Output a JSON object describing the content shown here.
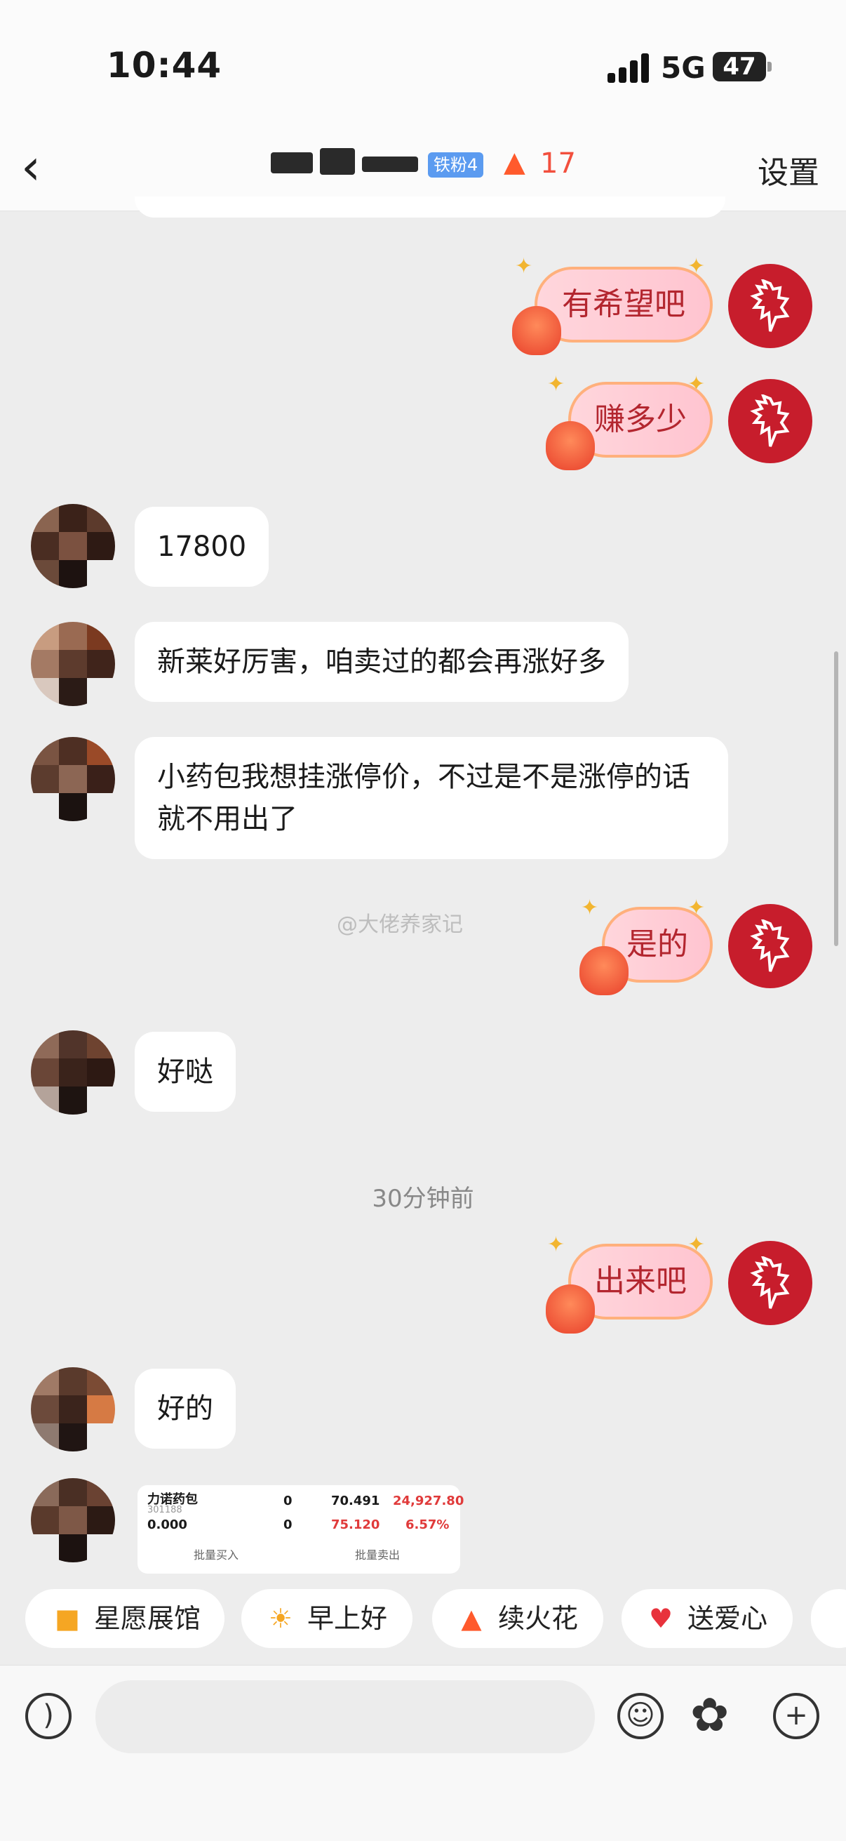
{
  "status_bar": {
    "time": "10:44",
    "network": "5G",
    "battery": "47"
  },
  "header": {
    "fan_badge": "铁粉4",
    "streak_count": "17",
    "settings_label": "设置"
  },
  "messages": [
    {
      "side": "right",
      "text": "有希望吧"
    },
    {
      "side": "right",
      "text": "赚多少"
    },
    {
      "side": "left",
      "text": "17800"
    },
    {
      "side": "left",
      "text": "新莱好厉害，咱卖过的都会再涨好多"
    },
    {
      "side": "left",
      "text": "小药包我想挂涨停价，不过是不是涨停的话就不用出了"
    },
    {
      "side": "right",
      "text": "是的"
    },
    {
      "side": "left",
      "text": "好哒"
    },
    {
      "side": "right",
      "text": "出来吧"
    },
    {
      "side": "left",
      "text": "好的"
    }
  ],
  "watermark": "@大佬养家记",
  "time_divider": "30分钟前",
  "stock_card": {
    "name": "力诺药包",
    "code": "301188",
    "row1": [
      "0",
      "70.491",
      "24,927.80"
    ],
    "row2_left": "0.000",
    "row2": [
      "0",
      "75.120",
      "6.57%"
    ],
    "buy_label": "批量买入",
    "sell_label": "批量卖出"
  },
  "quick_actions": [
    {
      "label": "星愿展馆",
      "icon": "gallery-icon"
    },
    {
      "label": "早上好",
      "icon": "sun-face-icon"
    },
    {
      "label": "续火花",
      "icon": "flame-icon"
    },
    {
      "label": "送爱心",
      "icon": "heart-icon"
    }
  ],
  "colors": {
    "accent_red": "#c71d2c",
    "bubble_pink": "#ffc4d0",
    "streak": "#f24f3d"
  }
}
